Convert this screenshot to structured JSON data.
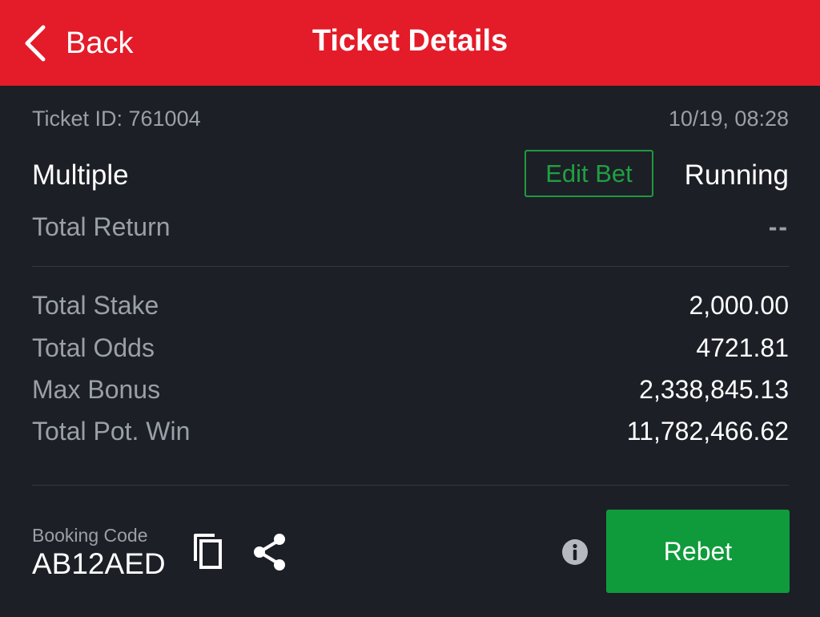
{
  "header": {
    "back_label": "Back",
    "title": "Ticket Details",
    "background_color": "#e41b28"
  },
  "ticket": {
    "id_text": "Ticket ID: 761004",
    "datetime": "10/19, 08:28",
    "bet_type": "Multiple",
    "edit_bet_label": "Edit Bet",
    "status": "Running",
    "total_return_label": "Total Return",
    "total_return_value": "--"
  },
  "stats": [
    {
      "label": "Total Stake",
      "value": "2,000.00"
    },
    {
      "label": "Total Odds",
      "value": "4721.81"
    },
    {
      "label": "Max Bonus",
      "value": "2,338,845.13"
    },
    {
      "label": "Total Pot. Win",
      "value": "11,782,466.62"
    }
  ],
  "footer": {
    "booking_code_label": "Booking Code",
    "booking_code": "AB12AED",
    "copy_icon": "copy-icon",
    "share_icon": "share-icon",
    "info_icon": "info-icon",
    "rebet_label": "Rebet",
    "accent_green": "#0f9b3c"
  }
}
